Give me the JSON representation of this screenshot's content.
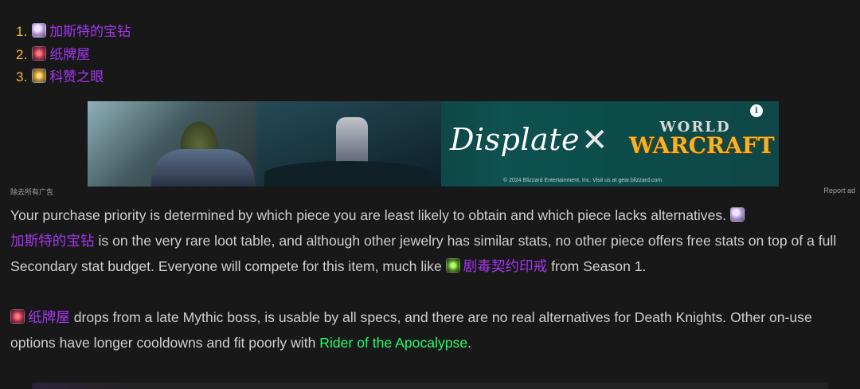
{
  "list": [
    {
      "num": "1.",
      "icon": "gem-icon",
      "name": "加斯特的宝钻"
    },
    {
      "num": "2.",
      "icon": "playing-cards-icon",
      "name": "纸牌屋"
    },
    {
      "num": "3.",
      "icon": "eye-icon",
      "name": "科赞之眼"
    }
  ],
  "ad": {
    "brand": "Displate",
    "cross": "✕",
    "game_line1": "WORLD",
    "game_line2": "WARCRAFT",
    "copyright": "© 2024 Blizzard Entertainment, Inc. Visit us at gear.blizzard.com",
    "info": "i",
    "remove_label": "除去所有广告",
    "report_label": "Report ad"
  },
  "para1": {
    "t1": "Your purchase priority is determined by which piece you are least likely to obtain and which piece lacks alternatives.",
    "item1": "加斯特的宝钻",
    "t2": "is on the very rare loot table, and although other jewelry has similar stats, no other piece offers free stats on top of a full Secondary stat budget. Everyone will compete for this item, much like",
    "item2": "剧毒契约印戒",
    "t3": "from Season 1."
  },
  "para2": {
    "item1": "纸牌屋",
    "t1": "drops from a late Mythic boss, is usable by all specs, and there are no real alternatives for Death Knights. Other on-use options have longer cooldowns and fit poorly with",
    "link": "Rider of the Apocalypse",
    "t2": "."
  },
  "colors": {
    "background": "#181818",
    "text": "#cfcfcf",
    "epic_item": "#a335ee",
    "uncommon_link": "#1eff6a",
    "list_number": "#f0b43a"
  }
}
